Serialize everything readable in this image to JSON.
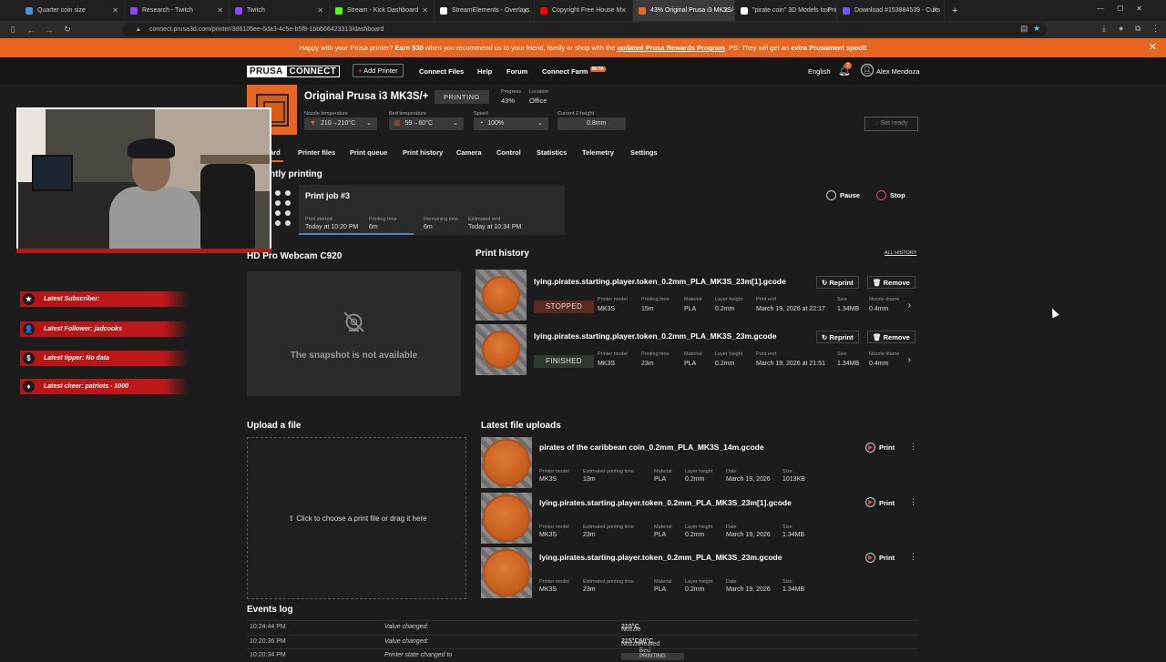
{
  "browser": {
    "tabs": [
      {
        "title": "Quarter coin size",
        "color": "#4a90e2"
      },
      {
        "title": "Research - Twitch",
        "color": "#9146ff"
      },
      {
        "title": "Twitch",
        "color": "#9146ff"
      },
      {
        "title": "Stream - Kick Dashboard",
        "color": "#53fc18"
      },
      {
        "title": "StreamElements - Overlays",
        "color": "#ffffff"
      },
      {
        "title": "Copyright Free House M",
        "color": "#ff0000"
      },
      {
        "title": "43% Original Prusa i3 MK3S/+",
        "color": "#e8661f"
      },
      {
        "title": "\"pirate coin\" 3D Models to Print",
        "color": "#ffffff"
      },
      {
        "title": "Download #153884539 - Cults",
        "color": "#6b5cff"
      }
    ],
    "new_tab": "+",
    "url": "connect.prusa3d.com/printer/3d6105ee-6da3-4c5e-b5f8-1bbb66423313/dashboard"
  },
  "promo": {
    "text_before": "Happy with your Prusa printer? ",
    "bold1": "Earn $30",
    "text_mid": " when you recommend us to your friend, family or shop with the ",
    "link": "updated Prusa Rewards Program",
    "text_after": ". PS: They will get an ",
    "bold2": "extra Prusament spool!",
    "close": "✕"
  },
  "nav": {
    "logo_a": "PRUSA",
    "logo_b": "CONNECT",
    "add_printer": "Add Printer",
    "files": "Connect Files",
    "help": "Help",
    "forum": "Forum",
    "farm": "Connect Farm",
    "beta": "BETA",
    "language": "English",
    "notif_count": "2",
    "user": "Alex Mendoza"
  },
  "printer": {
    "name": "Original Prusa i3 MK3S/+",
    "status": "PRINTING",
    "progress_label": "Progress",
    "progress": "43%",
    "location_label": "Location",
    "location": "Office",
    "nozzle_label": "Nozzle temperature",
    "nozzle": "210→210°C",
    "bed_label": "Bed temperature",
    "bed": "59→60°C",
    "speed_label": "Speed",
    "speed": "100%",
    "z_label": "Current Z-height",
    "z": "0.8mm",
    "set_ready": "Set ready"
  },
  "tabs": [
    "ard",
    "Printer files",
    "Print queue",
    "Print history",
    "Camera",
    "Control",
    "Statistics",
    "Telemetry",
    "Settings"
  ],
  "current": {
    "title": "ntly printing",
    "job": "Print job #3",
    "started_label": "Print started",
    "started": "Today at 10:20 PM",
    "time_label": "Printing time",
    "time": "6m",
    "remaining_label": "Remaining time",
    "remaining": "6m",
    "end_label": "Estimated end",
    "end": "Today at 10:34 PM",
    "progress_fraction": 0.43,
    "pause": "Pause",
    "stop": "Stop"
  },
  "stream_labels": [
    {
      "icon": "★",
      "text": "Latest Subscriber:"
    },
    {
      "icon": "👤",
      "text": "Latest Follower: jadcooks"
    },
    {
      "icon": "$",
      "text": "Latest tipper: No data"
    },
    {
      "icon": "♦",
      "text": "Latest cheer: patriots - 1000"
    }
  ],
  "camera": {
    "title": "HD Pro Webcam C920",
    "empty": "The snapshot is not available"
  },
  "history": {
    "title": "Print history",
    "all": "ALL HISTORY",
    "col_labels": {
      "model": "Printer model",
      "time": "Printing time",
      "material": "Material",
      "layer": "Layer height",
      "end": "Print end",
      "size": "Size",
      "nozzle": "Nozzle diame"
    },
    "reprint": "Reprint",
    "remove": "Remove",
    "rows": [
      {
        "name": "lying.pirates.starting.player.token_0.2mm_PLA_MK3S_23m[1].gcode",
        "state": "STOPPED",
        "state_color": "#5a2a20",
        "model": "MK3S",
        "time": "15m",
        "material": "PLA",
        "layer": "0.2mm",
        "end": "March 19, 2026 at 22:17",
        "size": "1.34MB",
        "nozzle": "0.4mm"
      },
      {
        "name": "lying.pirates.starting.player.token_0.2mm_PLA_MK3S_23m.gcode",
        "state": "FINISHED",
        "state_color": "#2e3a2e",
        "model": "MK3S",
        "time": "23m",
        "material": "PLA",
        "layer": "0.2mm",
        "end": "March 19, 2026 at 21:51",
        "size": "1.34MB",
        "nozzle": "0.4mm"
      }
    ]
  },
  "upload": {
    "title": "Upload a file",
    "text": "Click to choose a print file or drag it here"
  },
  "latest": {
    "title": "Latest file uploads",
    "col_labels": {
      "model": "Printer model",
      "time": "Estimated printing time",
      "material": "Material",
      "layer": "Layer height",
      "date": "Date",
      "size": "Size"
    },
    "print": "Print",
    "rows": [
      {
        "name": "pirates of the caribbean coin_0.2mm_PLA_MK3S_14m.gcode",
        "model": "MK3S",
        "time": "13m",
        "material": "PLA",
        "layer": "0.2mm",
        "date": "March 19, 2026",
        "size": "1013KB"
      },
      {
        "name": "lying.pirates.starting.player.token_0.2mm_PLA_MK3S_23m[1].gcode",
        "model": "MK3S",
        "time": "23m",
        "material": "PLA",
        "layer": "0.2mm",
        "date": "March 19, 2026",
        "size": "1.34MB"
      },
      {
        "name": "lying.pirates.starting.player.token_0.2mm_PLA_MK3S_23m.gcode",
        "model": "MK3S",
        "time": "23m",
        "material": "PLA",
        "layer": "0.2mm",
        "date": "March 19, 2026",
        "size": "1.34MB"
      }
    ]
  },
  "events": {
    "title": "Events log",
    "rows": [
      {
        "time": "10:24:44 PM",
        "event": "Value changed:",
        "detail_a": "Nozzle ",
        "detail_b": "210°C",
        "detail_c": "",
        "detail_d": ""
      },
      {
        "time": "10:20:36 PM",
        "event": "Value changed:",
        "detail_a": "Nozzle ",
        "detail_b": "215°C",
        "detail_c": " Heated Bed ",
        "detail_d": "60°C"
      },
      {
        "time": "10:20:34 PM",
        "event": "Printer state changed to",
        "detail_a": "",
        "detail_b": "",
        "detail_c": "",
        "detail_d": ""
      }
    ],
    "state_tag": "PRINTING"
  }
}
